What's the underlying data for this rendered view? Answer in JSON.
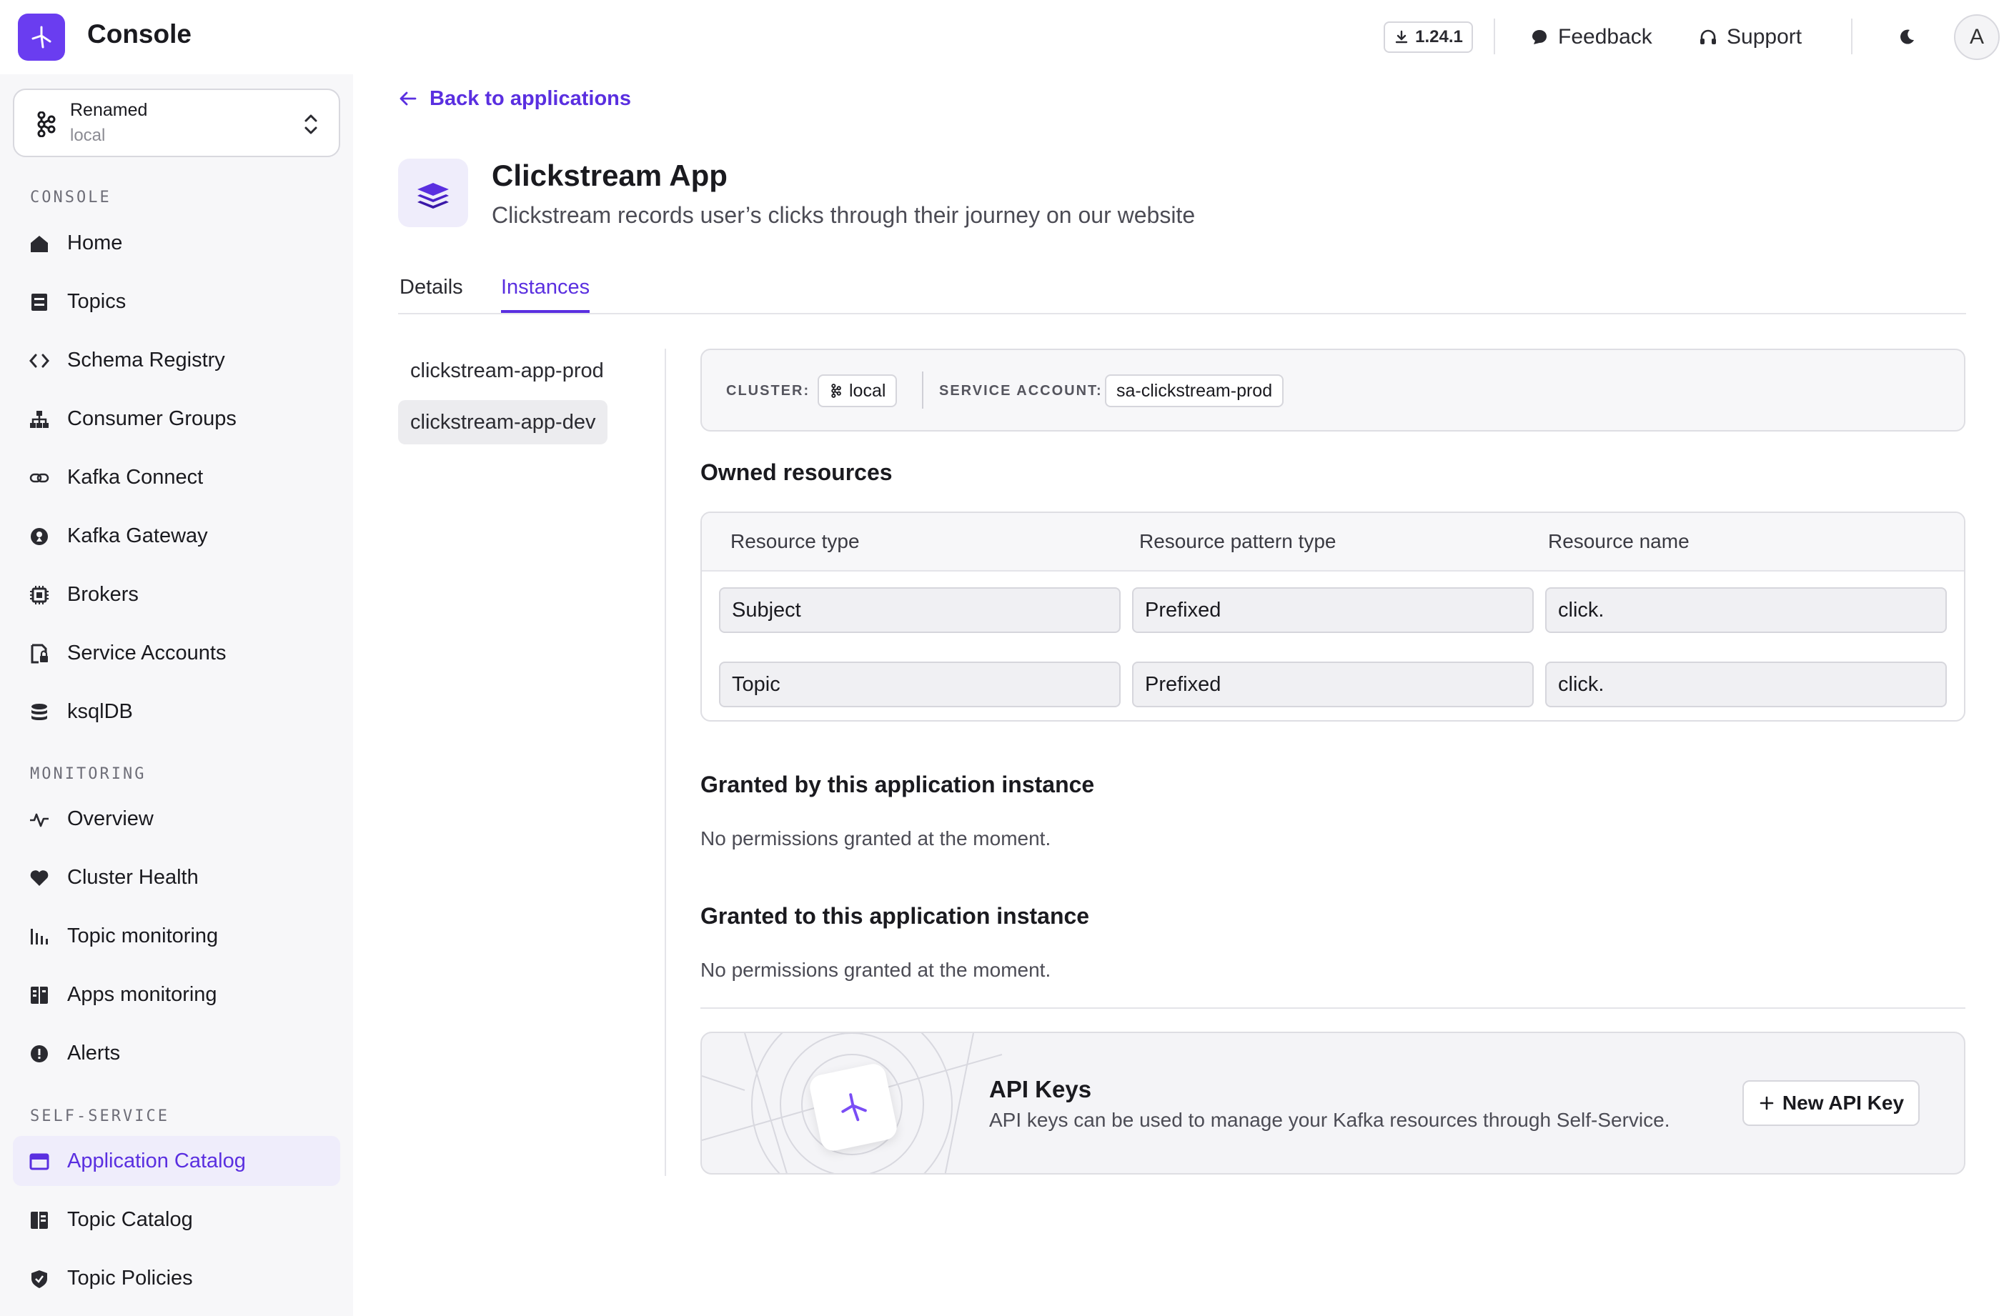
{
  "topbar": {
    "title": "Console",
    "version": "1.24.1",
    "feedback": "Feedback",
    "support": "Support",
    "avatar_initial": "A"
  },
  "cluster": {
    "name": "Renamed",
    "env": "local"
  },
  "sidebar": {
    "sections": {
      "console": "CONSOLE",
      "monitoring": "MONITORING",
      "self_service": "SELF-SERVICE"
    },
    "items": [
      {
        "label": "Home",
        "icon": "home-icon"
      },
      {
        "label": "Topics",
        "icon": "topics-icon"
      },
      {
        "label": "Schema Registry",
        "icon": "code-icon"
      },
      {
        "label": "Consumer Groups",
        "icon": "hierarchy-icon"
      },
      {
        "label": "Kafka Connect",
        "icon": "link-icon"
      },
      {
        "label": "Kafka Gateway",
        "icon": "gateway-icon"
      },
      {
        "label": "Brokers",
        "icon": "chip-icon"
      },
      {
        "label": "Service Accounts",
        "icon": "account-lock-icon"
      },
      {
        "label": "ksqlDB",
        "icon": "database-icon"
      },
      {
        "label": "Overview",
        "icon": "pulse-icon"
      },
      {
        "label": "Cluster Health",
        "icon": "heart-icon"
      },
      {
        "label": "Topic monitoring",
        "icon": "bar-chart-icon"
      },
      {
        "label": "Apps monitoring",
        "icon": "grid-icon"
      },
      {
        "label": "Alerts",
        "icon": "alert-icon"
      },
      {
        "label": "Application Catalog",
        "icon": "catalog-icon"
      },
      {
        "label": "Topic Catalog",
        "icon": "book-icon"
      },
      {
        "label": "Topic Policies",
        "icon": "shield-icon"
      }
    ],
    "active": "Application Catalog"
  },
  "main": {
    "back_label": "Back to applications",
    "app_name": "Clickstream App",
    "app_description": "Clickstream records user’s clicks through their journey on our website",
    "tabs": [
      {
        "label": "Details"
      },
      {
        "label": "Instances"
      }
    ],
    "active_tab": "Instances",
    "instances": [
      "clickstream-app-prod",
      "clickstream-app-dev"
    ],
    "active_instance": "clickstream-app-dev",
    "info": {
      "cluster_label": "CLUSTER:",
      "cluster_value": "local",
      "service_account_label": "SERVICE ACCOUNT:",
      "service_account_value": "sa-clickstream-prod"
    },
    "owned_resources": {
      "title": "Owned resources",
      "columns": [
        "Resource type",
        "Resource pattern type",
        "Resource name"
      ],
      "rows": [
        [
          "Subject",
          "Prefixed",
          "click."
        ],
        [
          "Topic",
          "Prefixed",
          "click."
        ]
      ]
    },
    "granted_by": {
      "title": "Granted by this application instance",
      "empty": "No permissions granted at the moment."
    },
    "granted_to": {
      "title": "Granted to this application instance",
      "empty": "No permissions granted at the moment."
    },
    "api_keys": {
      "title": "API Keys",
      "description": "API keys can be used to manage your Kafka resources through Self-Service.",
      "button": "New API Key"
    }
  },
  "colors": {
    "accent": "#5a2fe0",
    "brand": "#6a3df0",
    "active_bg": "#efedfb"
  }
}
